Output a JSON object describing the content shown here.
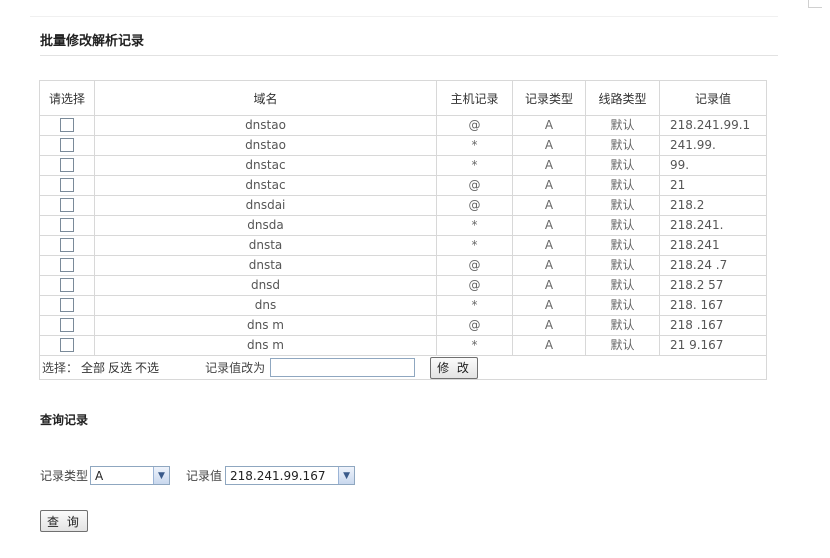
{
  "batch": {
    "title": "批量修改解析记录",
    "headers": {
      "select": "请选择",
      "domain": "域名",
      "host": "主机记录",
      "type": "记录类型",
      "line": "线路类型",
      "value": "记录值"
    },
    "rows": [
      {
        "domain": "dnstao",
        "host": "@",
        "type": "A",
        "line": "默认",
        "value": "218.241.99.1"
      },
      {
        "domain": "dnstao",
        "host": "*",
        "type": "A",
        "line": "默认",
        "value": "241.99."
      },
      {
        "domain": "dnstac",
        "host": "*",
        "type": "A",
        "line": "默认",
        "value": "99."
      },
      {
        "domain": "dnstac",
        "host": "@",
        "type": "A",
        "line": "默认",
        "value": "21"
      },
      {
        "domain": "dnsdai",
        "host": "@",
        "type": "A",
        "line": "默认",
        "value": "218.2"
      },
      {
        "domain": "dnsda",
        "host": "*",
        "type": "A",
        "line": "默认",
        "value": "218.241."
      },
      {
        "domain": "dnsta",
        "host": "*",
        "type": "A",
        "line": "默认",
        "value": "218.241"
      },
      {
        "domain": "dnsta",
        "host": "@",
        "type": "A",
        "line": "默认",
        "value": "218.24   .7"
      },
      {
        "domain": "dnsd",
        "host": "@",
        "type": "A",
        "line": "默认",
        "value": "218.2   57"
      },
      {
        "domain": "dns",
        "host": "*",
        "type": "A",
        "line": "默认",
        "value": "218.   167"
      },
      {
        "domain": "dns        m",
        "host": "@",
        "type": "A",
        "line": "默认",
        "value": "218   .167"
      },
      {
        "domain": "dns        m",
        "host": "*",
        "type": "A",
        "line": "默认",
        "value": "21   9.167"
      }
    ],
    "footer": {
      "select_label": "选择：",
      "select_all": "全部",
      "invert": "反选",
      "none": "不选",
      "change_label": "记录值改为",
      "input_value": "",
      "modify_button": "修 改"
    }
  },
  "query": {
    "title": "查询记录",
    "type_label": "记录类型",
    "type_selected": "A",
    "value_label": "记录值",
    "value_selected": "218.241.99.167",
    "button": "查 询"
  }
}
